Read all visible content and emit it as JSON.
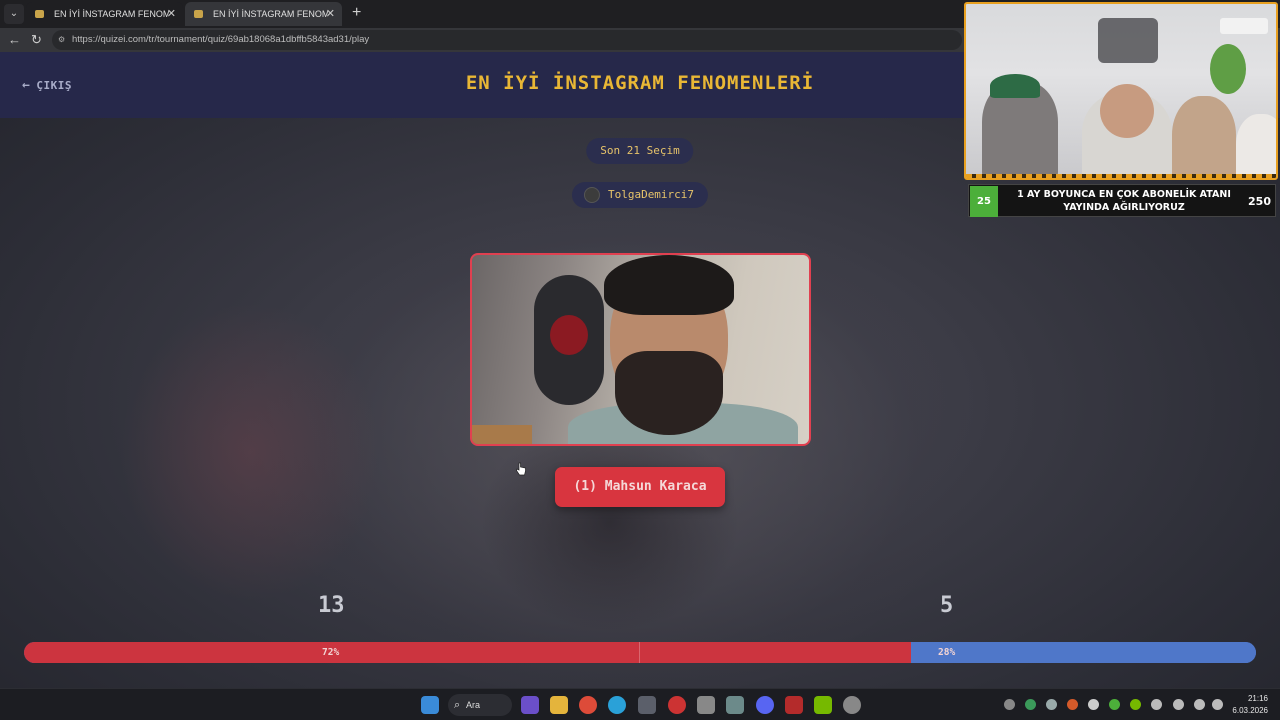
{
  "browser": {
    "tabs": [
      {
        "title": "EN İYİ İNSTAGRAM FENOMENLERİ"
      },
      {
        "title": "EN İYİ İNSTAGRAM FENOMENLERİ"
      }
    ],
    "url": "https://quizei.com/tr/tournament/quiz/69ab18068a1dbffb5843ad31/play"
  },
  "page": {
    "exit_label": "ÇIKIŞ",
    "title": "EN İYİ İNSTAGRAM FENOMENLERİ",
    "round_label": "Son 21 Seçim",
    "username": "TolgaDemirci7",
    "choice_label": "(1) Mahsun Karaca",
    "votes": {
      "left_count": "13",
      "right_count": "5",
      "left_percent_label": "72%",
      "right_percent_label": "28%",
      "left_fraction": 0.72
    }
  },
  "overlay": {
    "sub_goal_current": "25",
    "sub_goal_text": "1 AY BOYUNCA EN ÇOK ABONELİK ATANI YAYINDA AĞIRLIYORUZ",
    "sub_goal_target": "250"
  },
  "taskbar": {
    "search_label": "Ara",
    "time": "21:16",
    "date": "6.03.2026"
  },
  "colors": {
    "accent_title": "#e9b735",
    "vote_left": "#cc343f",
    "vote_right": "#4f77c9",
    "choice_button": "#d8353f"
  }
}
